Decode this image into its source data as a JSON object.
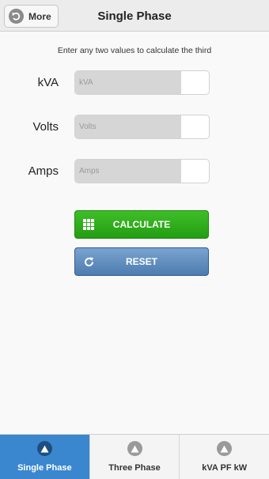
{
  "header": {
    "more_label": "More",
    "title": "Single Phase"
  },
  "instructions": "Enter any two values to calculate the third",
  "fields": [
    {
      "label": "kVA",
      "placeholder": "kVA",
      "value": ""
    },
    {
      "label": "Volts",
      "placeholder": "Volts",
      "value": ""
    },
    {
      "label": "Amps",
      "placeholder": "Amps",
      "value": ""
    }
  ],
  "buttons": {
    "calculate_label": "CALCULATE",
    "reset_label": "RESET"
  },
  "tabs": [
    {
      "label": "Single Phase",
      "active": true,
      "icon": "triangle-icon"
    },
    {
      "label": "Three Phase",
      "active": false,
      "icon": "triangle-icon"
    },
    {
      "label": "kVA PF kW",
      "active": false,
      "icon": "triangle-icon"
    }
  ],
  "colors": {
    "calculate": "#2aa617",
    "reset": "#5b88bb",
    "active_tab": "#3a87cf"
  }
}
